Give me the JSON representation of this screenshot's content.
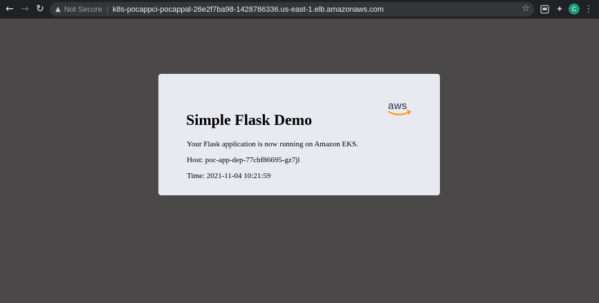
{
  "browser": {
    "back_icon": "arrow-left-icon",
    "forward_icon": "arrow-right-icon",
    "reload_icon": "reload-icon",
    "security_warning": "Not Secure",
    "url": "k8s-pocappci-pocappal-26e2f7ba98-1428786336.us-east-1.elb.amazonaws.com",
    "profile_initial": "C",
    "profile_color": "#1a9c7c"
  },
  "page": {
    "logo_text": "aws",
    "logo_smile_color": "#ff9900",
    "title": "Simple Flask Demo",
    "message": "Your Flask application is now running on Amazon EKS.",
    "host": "Host: poc-app-dep-77cbf86695-gz7jl",
    "time": "Time: 2021-11-04 10:21:59"
  }
}
